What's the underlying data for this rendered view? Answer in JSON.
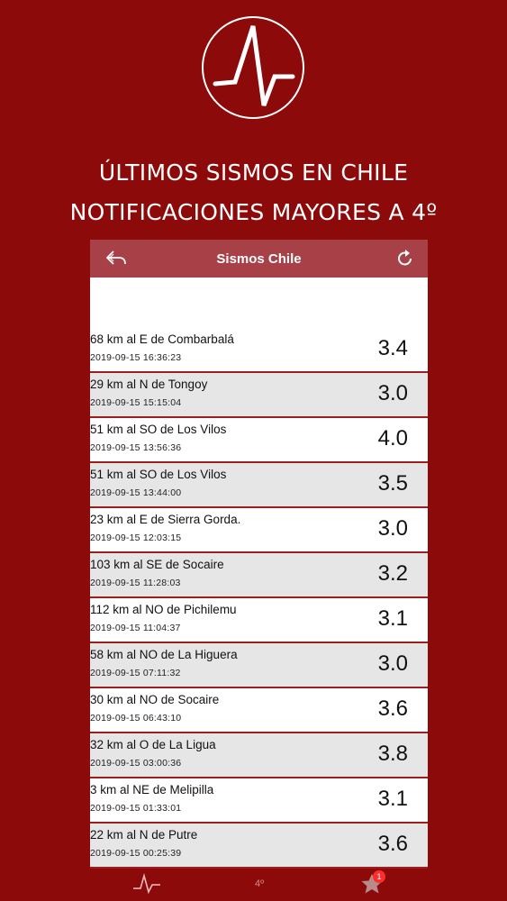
{
  "headline": {
    "line1": "ÚLTIMOS SISMOS EN CHILE",
    "line2": "NOTIFICACIONES MAYORES A 4º"
  },
  "navbar": {
    "title": "Sismos Chile"
  },
  "quakes": [
    {
      "location": "68 km al E de Combarbalá",
      "datetime": "2019-09-15 16:36:23",
      "magnitude": "3.4"
    },
    {
      "location": "29 km al N de Tongoy",
      "datetime": "2019-09-15 15:15:04",
      "magnitude": "3.0"
    },
    {
      "location": "51 km al SO de Los Vilos",
      "datetime": "2019-09-15 13:56:36",
      "magnitude": "4.0"
    },
    {
      "location": "51 km al SO de Los Vilos",
      "datetime": "2019-09-15 13:44:00",
      "magnitude": "3.5"
    },
    {
      "location": "23 km al E de Sierra Gorda.",
      "datetime": "2019-09-15 12:03:15",
      "magnitude": "3.0"
    },
    {
      "location": "103 km al SE de Socaire",
      "datetime": "2019-09-15 11:28:03",
      "magnitude": "3.2"
    },
    {
      "location": "112 km al NO de Pichilemu",
      "datetime": "2019-09-15 11:04:37",
      "magnitude": "3.1"
    },
    {
      "location": "58 km al NO de La Higuera",
      "datetime": "2019-09-15 07:11:32",
      "magnitude": "3.0"
    },
    {
      "location": "30 km al NO de Socaire",
      "datetime": "2019-09-15 06:43:10",
      "magnitude": "3.6"
    },
    {
      "location": "32 km al O de La Ligua",
      "datetime": "2019-09-15 03:00:36",
      "magnitude": "3.8"
    },
    {
      "location": "3 km al NE de Melipilla",
      "datetime": "2019-09-15 01:33:01",
      "magnitude": "3.1"
    },
    {
      "location": "22 km al N de Putre",
      "datetime": "2019-09-15 00:25:39",
      "magnitude": "3.6"
    }
  ],
  "tabbar": {
    "badge_count": "1",
    "tab2_icon_text": "4º"
  },
  "colors": {
    "background": "#8c0a0a",
    "navbar": "#a84047",
    "row_divider": "#9c1e1e"
  }
}
